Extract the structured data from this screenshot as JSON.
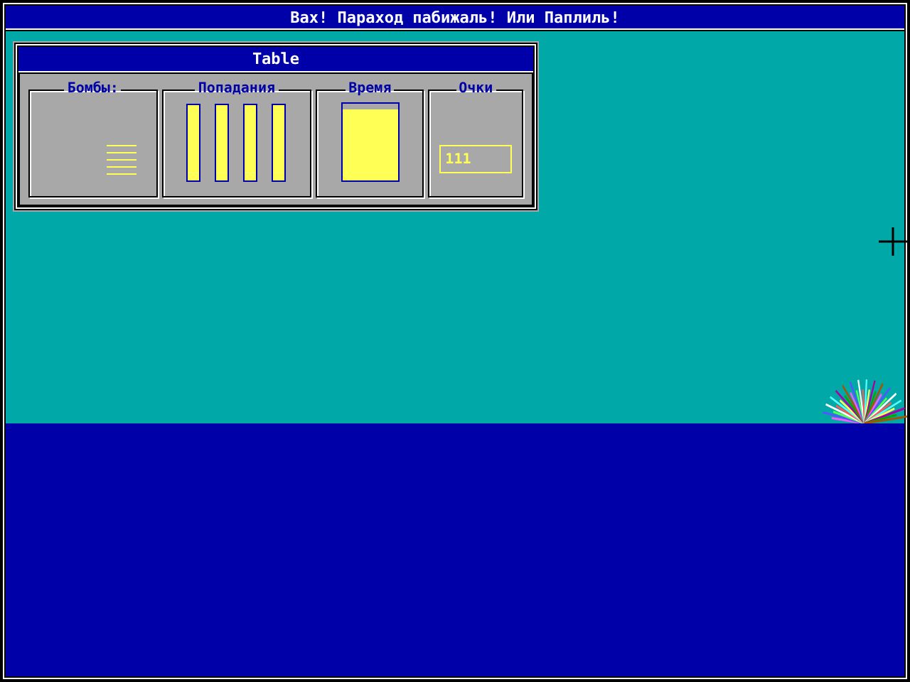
{
  "window": {
    "title": "Вах! Параход пабижаль! Или Паплиль!"
  },
  "table": {
    "title": "Table",
    "bombs": {
      "label": "Бомбы:",
      "items": [
        {
          "kind": "bomb"
        },
        {
          "kind": "bomb"
        },
        {
          "kind": "bomb"
        },
        {
          "kind": "bomb"
        },
        {
          "kind": "bomb"
        }
      ]
    },
    "hits": {
      "label": "Попадания",
      "items": [
        {
          "level": 1
        },
        {
          "level": 1
        },
        {
          "level": 1
        },
        {
          "level": 1
        }
      ]
    },
    "time": {
      "label": "Время",
      "level": 0.92
    },
    "score": {
      "label": "Очки",
      "value": "111"
    }
  }
}
